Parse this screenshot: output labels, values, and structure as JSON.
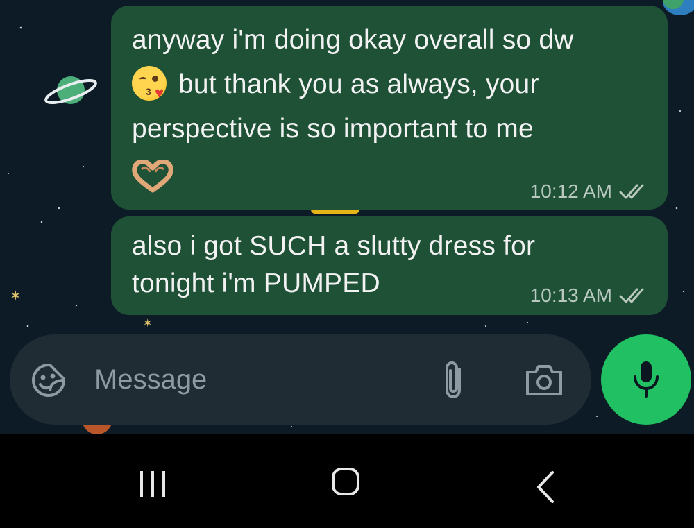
{
  "messages": [
    {
      "text_line1": "anyway i'm doing okay overall so dw",
      "text_line2": "but thank you as always, your",
      "text_line3": "perspective is so important to me",
      "emoji_1": "face-blowing-a-kiss-emoji",
      "emoji_2": "heart-hands-emoji",
      "time": "10:12 AM",
      "status": "read"
    },
    {
      "text_line1": "also i got SUCH a slutty dress for",
      "text_line2": "tonight i'm PUMPED",
      "time": "10:13 AM",
      "status": "read"
    }
  ],
  "composer": {
    "placeholder": "Message",
    "icons": [
      "sticker-icon",
      "attach-icon",
      "camera-icon",
      "mic-icon"
    ]
  },
  "nav_icons": [
    "recents-icon",
    "home-icon",
    "back-icon"
  ],
  "colors": {
    "outgoing_bubble": "#1e5136",
    "composer_bg": "#1f2c34",
    "mic_button": "#21c063",
    "background": "#0d1b26"
  }
}
